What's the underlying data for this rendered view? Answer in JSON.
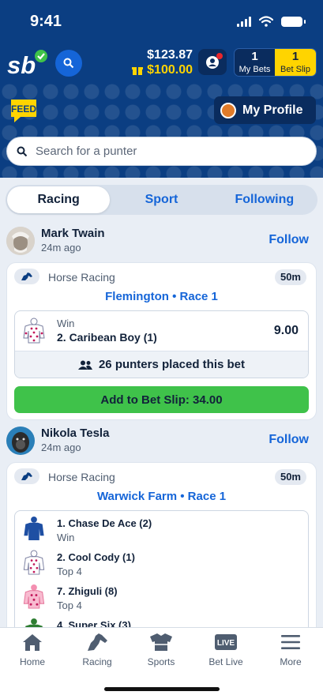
{
  "status": {
    "time": "9:41"
  },
  "header": {
    "balance": "$123.87",
    "bonus": "$100.00",
    "my_bets_count": "1",
    "my_bets_label": "My Bets",
    "bet_slip_count": "1",
    "bet_slip_label": "Bet Slip",
    "feed_logo_text": "FEED",
    "profile_label": "My Profile",
    "search_placeholder": "Search for a punter"
  },
  "tabs": [
    {
      "label": "Racing",
      "active": true
    },
    {
      "label": "Sport",
      "active": false
    },
    {
      "label": "Following",
      "active": false
    }
  ],
  "posts": [
    {
      "user": "Mark Twain",
      "ago": "24m ago",
      "follow_label": "Follow",
      "sport": "Horse Racing",
      "time_badge": "50m",
      "race": "Flemington • Race 1",
      "bet_type": "Win",
      "selection": "2. Caribean Boy (1)",
      "odds": "9.00",
      "punters": "26 punters placed this bet",
      "add_label": "Add to Bet Slip: 34.00"
    },
    {
      "user": "Nikola Tesla",
      "ago": "24m ago",
      "follow_label": "Follow",
      "sport": "Horse Racing",
      "time_badge": "50m",
      "race": "Warwick Farm • Race 1",
      "selections": [
        {
          "name": "1. Chase De Ace (2)",
          "type": "Win"
        },
        {
          "name": "2. Cool Cody (1)",
          "type": "Top 4"
        },
        {
          "name": "7. Zhiguli (8)",
          "type": "Top 4"
        },
        {
          "name": "4. Super Six (3)",
          "type": ""
        }
      ]
    }
  ],
  "nav": [
    {
      "label": "Home",
      "icon": "home-icon"
    },
    {
      "label": "Racing",
      "icon": "horse-icon"
    },
    {
      "label": "Sports",
      "icon": "jersey-icon"
    },
    {
      "label": "Bet Live",
      "icon": "live-icon"
    },
    {
      "label": "More",
      "icon": "menu-icon"
    }
  ],
  "colors": {
    "header": "#0b3e82",
    "accent": "#1565d8",
    "bet_slip": "#ffd400",
    "add_button": "#3fc24a"
  }
}
